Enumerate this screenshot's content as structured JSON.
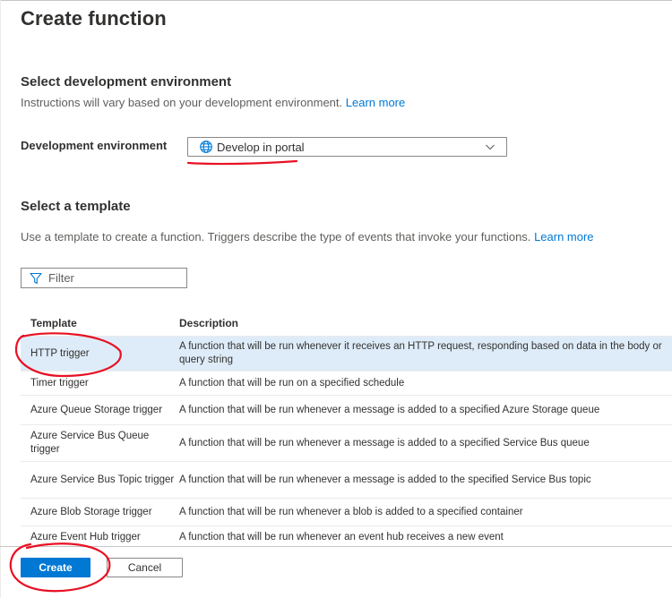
{
  "header": {
    "title": "Create function"
  },
  "dev_env": {
    "heading": "Select development environment",
    "description": "Instructions will vary based on your development environment.",
    "learn_more": "Learn more",
    "field_label": "Development environment",
    "selected_value": "Develop in portal"
  },
  "template": {
    "heading": "Select a template",
    "description": "Use a template to create a function. Triggers describe the type of events that invoke your functions.",
    "learn_more": "Learn more",
    "filter_placeholder": "Filter",
    "columns": {
      "template": "Template",
      "description": "Description"
    },
    "rows": [
      {
        "name": "HTTP trigger",
        "description": "A function that will be run whenever it receives an HTTP request, responding based on data in the body or query string"
      },
      {
        "name": "Timer trigger",
        "description": "A function that will be run on a specified schedule"
      },
      {
        "name": "Azure Queue Storage trigger",
        "description": "A function that will be run whenever a message is added to a specified Azure Storage queue"
      },
      {
        "name": "Azure Service Bus Queue trigger",
        "description": "A function that will be run whenever a message is added to a specified Service Bus queue"
      },
      {
        "name": "Azure Service Bus Topic trigger",
        "description": "A function that will be run whenever a message is added to the specified Service Bus topic"
      },
      {
        "name": "Azure Blob Storage trigger",
        "description": "A function that will be run whenever a blob is added to a specified container"
      },
      {
        "name": "Azure Event Hub trigger",
        "description": "A function that will be run whenever an event hub receives a new event"
      }
    ]
  },
  "footer": {
    "create_label": "Create",
    "cancel_label": "Cancel"
  },
  "colors": {
    "accent": "#0078d4",
    "selected_row": "#deecf9",
    "annotation": "#e81123"
  }
}
